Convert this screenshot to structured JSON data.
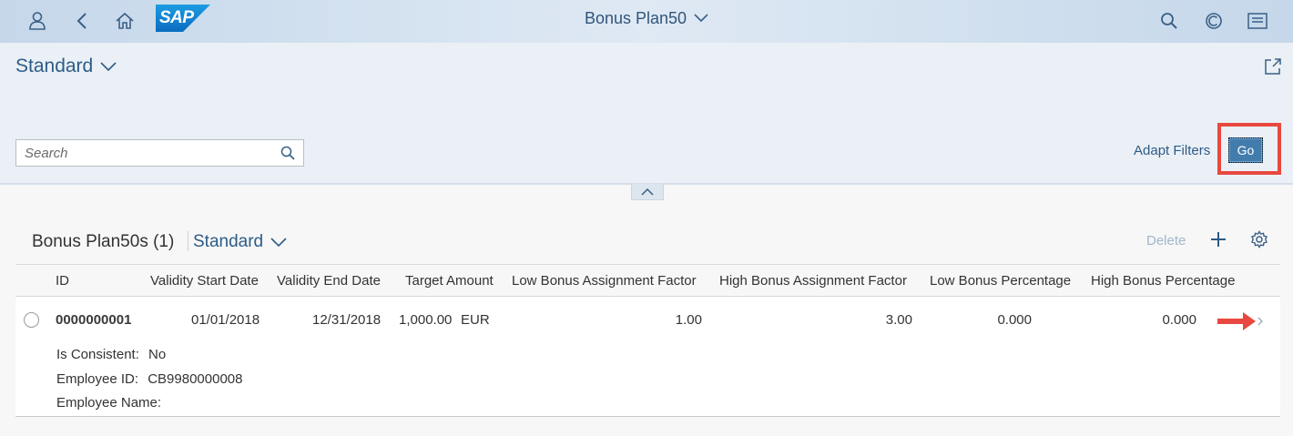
{
  "shell": {
    "title": "Bonus Plan50",
    "logo_text": "SAP",
    "icons": [
      "user-icon",
      "back-icon",
      "home-icon",
      "search-icon",
      "copilot-icon",
      "notifications-icon"
    ]
  },
  "header": {
    "variant": "Standard",
    "search_placeholder": "Search",
    "adapt_filters": "Adapt Filters",
    "go": "Go"
  },
  "table": {
    "title": "Bonus Plan50s (1)",
    "variant": "Standard",
    "delete": "Delete",
    "columns": [
      "ID",
      "Validity Start Date",
      "Validity End Date",
      "Target Amount",
      "Low Bonus Assignment Factor",
      "High Bonus Assignment Factor",
      "Low Bonus Percentage",
      "High Bonus Percentage"
    ],
    "rows": [
      {
        "id": "0000000001",
        "validity_start": "01/01/2018",
        "validity_end": "12/31/2018",
        "target_amount": "1,000.00",
        "currency": "EUR",
        "low_factor": "1.00",
        "high_factor": "3.00",
        "low_pct": "0.000",
        "high_pct": "0.000",
        "attributes": [
          {
            "label": "Is Consistent:",
            "value": "No"
          },
          {
            "label": "Employee ID:",
            "value": "CB9980000008"
          },
          {
            "label": "Employee Name:",
            "value": ""
          }
        ]
      }
    ]
  },
  "colors": {
    "brand_blue": "#2d5b87",
    "go_button": "#427cac",
    "highlight_red": "#e8483f"
  }
}
